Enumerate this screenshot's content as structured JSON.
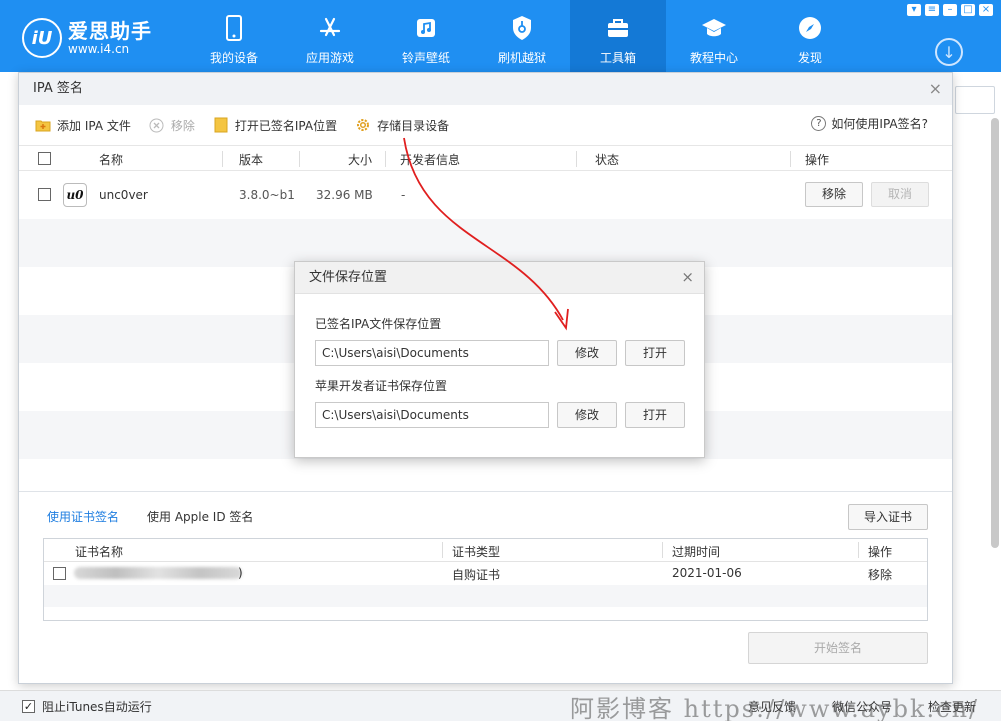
{
  "app": {
    "name": "爱思助手",
    "url": "www.i4.cn",
    "nav": [
      {
        "label": "我的设备",
        "icon": "phone-icon"
      },
      {
        "label": "应用游戏",
        "icon": "app-store-icon"
      },
      {
        "label": "铃声壁纸",
        "icon": "music-icon"
      },
      {
        "label": "刷机越狱",
        "icon": "shield-key-icon"
      },
      {
        "label": "工具箱",
        "icon": "toolbox-icon"
      },
      {
        "label": "教程中心",
        "icon": "graduation-cap-icon"
      },
      {
        "label": "发现",
        "icon": "compass-icon"
      }
    ],
    "active_nav": "工具箱",
    "brand_color": "#1f8ff2"
  },
  "dialog": {
    "title": "IPA 签名",
    "toolbar": {
      "add_ipa": "添加 IPA 文件",
      "remove": "移除",
      "open_signed": "打开已签名IPA位置",
      "storage_settings": "存储目录设备"
    },
    "help": "如何使用IPA签名?",
    "columns": {
      "name": "名称",
      "version": "版本",
      "size": "大小",
      "developer": "开发者信息",
      "status": "状态",
      "action": "操作"
    },
    "rows": [
      {
        "icon_text": "u0",
        "name": "unc0ver",
        "version": "3.8.0~b1",
        "size": "32.96 MB",
        "developer": "-",
        "status": "",
        "remove": "移除",
        "cancel": "取消"
      }
    ],
    "cert": {
      "tab_cert": "使用证书签名",
      "tab_apple_id": "使用 Apple ID 签名",
      "import": "导入证书",
      "columns": {
        "name": "证书名称",
        "type": "证书类型",
        "expiry": "过期时间",
        "action": "操作"
      },
      "rows": [
        {
          "name_suffix": ")",
          "type": "自购证书",
          "expiry": "2021-01-06",
          "action": "移除"
        }
      ],
      "start": "开始签名"
    }
  },
  "popup": {
    "title": "文件保存位置",
    "signed_label": "已签名IPA文件保存位置",
    "signed_path": "C:\\Users\\aisi\\Documents",
    "cert_label": "苹果开发者证书保存位置",
    "cert_path": "C:\\Users\\aisi\\Documents",
    "modify": "修改",
    "open": "打开"
  },
  "status": {
    "block_itunes": "阻止iTunes自动运行",
    "feedback": "意见反馈",
    "wechat": "微信公众号",
    "update": "检查更新",
    "watermark": "阿影博客 https://www.aybk.cn/"
  }
}
